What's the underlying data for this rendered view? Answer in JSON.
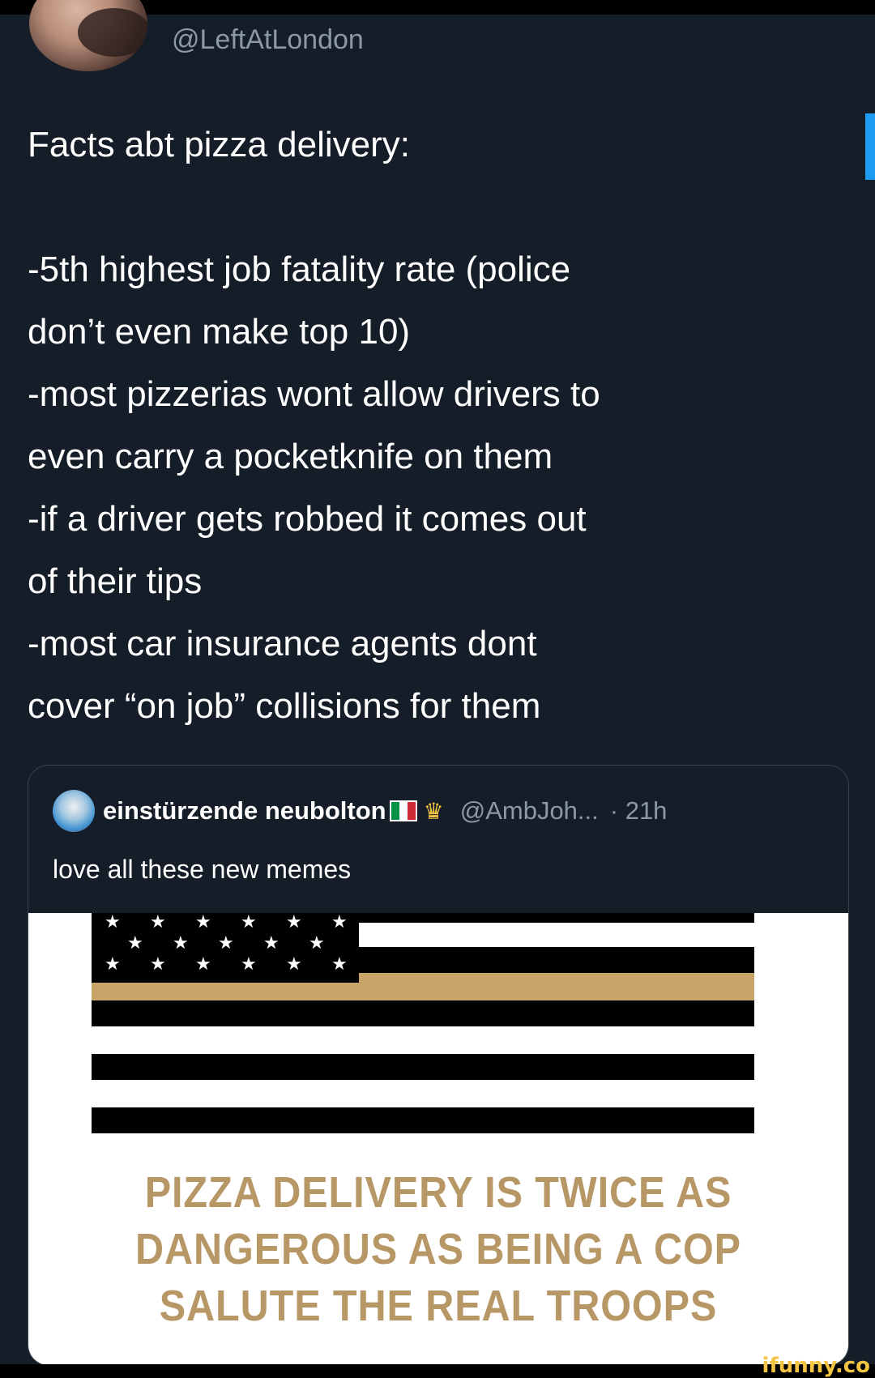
{
  "tweet": {
    "handle": "@LeftAtLondon",
    "lines": [
      "Facts abt pizza delivery:",
      "-5th highest job fatality rate (police",
      "don’t even make top 10)",
      "-most pizzerias wont allow drivers to",
      "even carry a pocketknife on them",
      "-if a driver gets robbed it comes out",
      "of their tips",
      "-most car insurance agents dont",
      "cover “on job” collisions for them"
    ]
  },
  "quoted": {
    "name": "einstürzende neubolton",
    "handle": "@AmbJoh...",
    "time": "· 21h",
    "text": "love all these new memes",
    "meme": {
      "lines": [
        "PIZZA DELIVERY IS TWICE AS",
        "DANGEROUS AS BEING A COP",
        "SALUTE THE REAL TROOPS"
      ],
      "colors": {
        "gold": "#c8a468",
        "text": "#b89766",
        "black": "#000000",
        "white": "#ffffff"
      }
    }
  },
  "watermark": "ifunny.co",
  "colors": {
    "background": "#151d28",
    "muted": "#8b98a5",
    "accent": "#1d9bf0",
    "border": "#38444d"
  }
}
